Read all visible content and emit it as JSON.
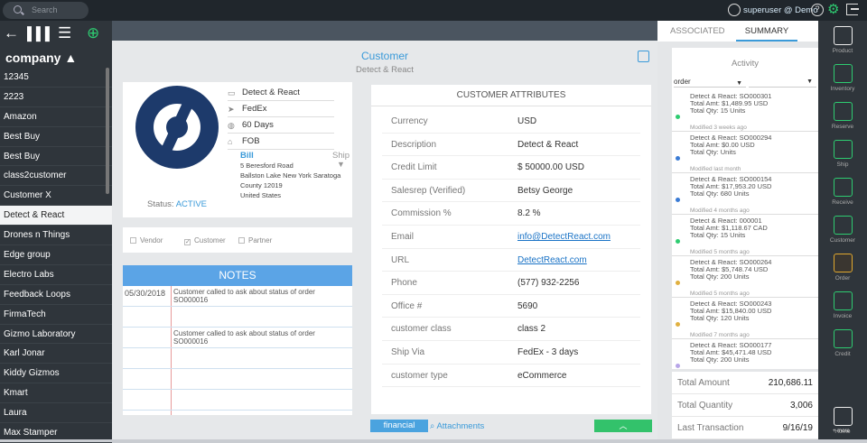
{
  "top": {
    "search_placeholder": "Search",
    "user": "superuser @ Demo",
    "help": "?"
  },
  "sidebar": {
    "header": "company ▲",
    "items": [
      "12345",
      "2223",
      "Amazon",
      "Best Buy",
      "Best Buy",
      "class2customer",
      "Customer X",
      "Detect & React",
      "Drones n Things",
      "Edge group",
      "Electro Labs",
      "Feedback Loops",
      "FirmaTech",
      "Gizmo Laboratory",
      "Karl Jonar",
      "Kiddy Gizmos",
      "Kmart",
      "Laura",
      "Max Stamper"
    ]
  },
  "customer": {
    "title": "Customer",
    "subtitle": "Detect & React",
    "name": "Detect & React",
    "carrier": "FedEx",
    "terms": "60 Days",
    "fob": "FOB",
    "bill_label": "Bill",
    "ship_label": "Ship",
    "address": [
      "5 Beresford Road",
      "Ballston Lake New York Saratoga",
      "County 12019",
      "United States"
    ],
    "status_label": "Status:",
    "status_value": "ACTIVE",
    "checks": {
      "vendor": "Vendor",
      "customer": "Customer",
      "partner": "Partner"
    }
  },
  "notes": {
    "title": "NOTES",
    "rows": [
      {
        "date": "05/30/2018",
        "text": "Customer called to ask about status of order SO000016"
      },
      {
        "date": "",
        "text": "Customer called to ask about status of order SO000016"
      }
    ]
  },
  "attributes": {
    "title": "CUSTOMER ATTRIBUTES",
    "rows": [
      {
        "k": "Currency",
        "v": "USD"
      },
      {
        "k": "Description",
        "v": "Detect & React"
      },
      {
        "k": "Credit Limit",
        "v": "$ 50000.00 USD"
      },
      {
        "k": "Salesrep (Verified)",
        "v": "Betsy George"
      },
      {
        "k": "Commission %",
        "v": "8.2 %"
      },
      {
        "k": "Email",
        "v": "info@DetectReact.com"
      },
      {
        "k": "URL",
        "v": "DetectReact.com"
      },
      {
        "k": "Phone",
        "v": "(577) 932-2256"
      },
      {
        "k": "Office #",
        "v": "5690"
      },
      {
        "k": "customer class",
        "v": "class 2"
      },
      {
        "k": "Ship Via",
        "v": "FedEx - 3 days"
      },
      {
        "k": "customer type",
        "v": "eCommerce"
      }
    ]
  },
  "bottom": {
    "financial": "financial",
    "attachments": "Attachments"
  },
  "right": {
    "tab_associated": "ASSOCIATED",
    "tab_summary": "SUMMARY",
    "activity_title": "Activity",
    "filter": "order",
    "activities": [
      {
        "line1": "Detect & React: SO000301",
        "line2": "Total Amt: $1,489.95 USD",
        "line3": "Total Qty: 15 Units",
        "mod": "Modified 3 weeks ago",
        "color": "#2ecc71"
      },
      {
        "line1": "Detect & React: SO000294",
        "line2": "Total Amt: $0.00 USD",
        "line3": "Total Qty:  Units",
        "mod": "Modified last month",
        "color": "#3a7bd5"
      },
      {
        "line1": "Detect & React: SO000154",
        "line2": "Total Amt: $17,953.20 USD",
        "line3": "Total Qty: 680 Units",
        "mod": "Modified 4 months ago",
        "color": "#3a7bd5"
      },
      {
        "line1": "Detect & React: 000001",
        "line2": "Total Amt: $1,118.67 CAD",
        "line3": "Total Qty: 15 Units",
        "mod": "Modified 5 months ago",
        "color": "#2ecc71"
      },
      {
        "line1": "Detect & React: SO000264",
        "line2": "Total Amt: $5,748.74 USD",
        "line3": "Total Qty: 200 Units",
        "mod": "Modified 5 months ago",
        "color": "#e0b040"
      },
      {
        "line1": "Detect & React: SO000243",
        "line2": "Total Amt: $15,840.00 USD",
        "line3": "Total Qty: 120 Units",
        "mod": "Modified 7 months ago",
        "color": "#e0b040"
      },
      {
        "line1": "Detect & React: SO000177",
        "line2": "Total Amt: $45,471.48 USD",
        "line3": "Total Qty: 200 Units",
        "mod": "",
        "color": "#b7a5e8"
      }
    ],
    "totals": [
      {
        "k": "Total Amount",
        "v": "210,686.11"
      },
      {
        "k": "Total Quantity",
        "v": "3,006"
      },
      {
        "k": "Last Transaction",
        "v": "9/16/19"
      }
    ]
  },
  "rail": [
    "Product",
    "Inventory",
    "Reserve",
    "Ship",
    "Receive",
    "Customer",
    "Order",
    "Invoice",
    "Credit",
    "Home"
  ],
  "rail_more": "+ more"
}
